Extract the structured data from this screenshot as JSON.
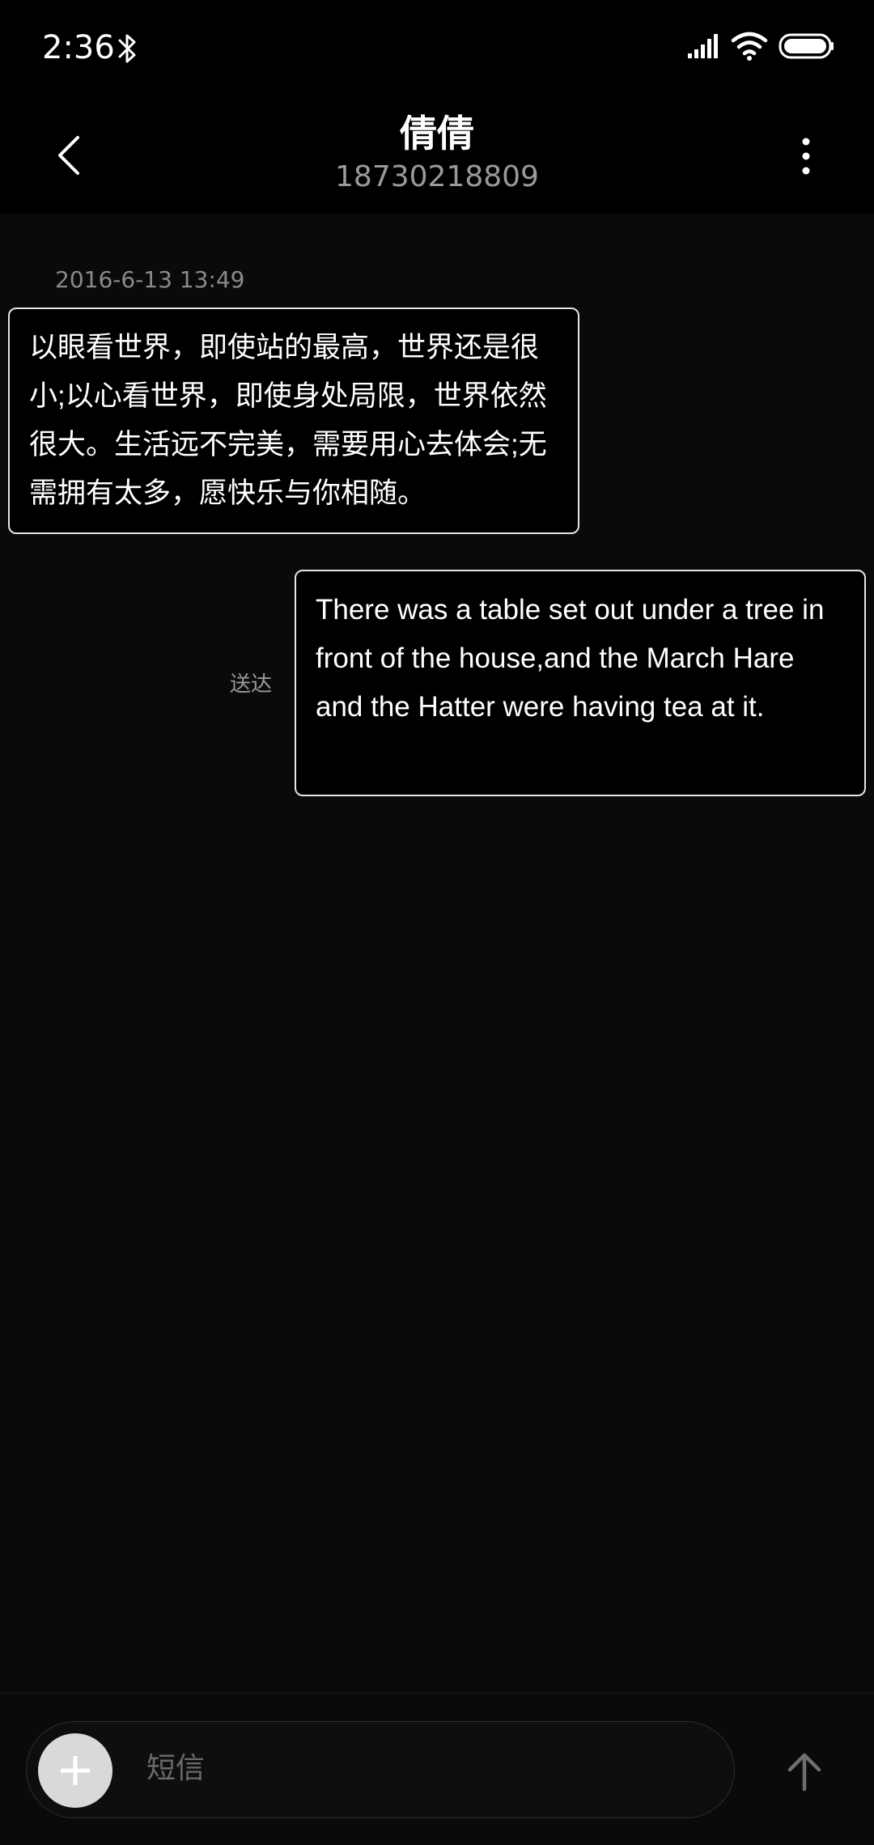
{
  "status_bar": {
    "time": "2:36",
    "icons": [
      "bluetooth-icon",
      "signal-icon",
      "wifi-icon",
      "battery-icon"
    ]
  },
  "header": {
    "contact_name": "倩倩",
    "phone_number": "18730218809",
    "icons": [
      "back-arrow-icon",
      "more-vertical-icon"
    ]
  },
  "conversation": {
    "timestamp": "2016-6-13 13:49",
    "messages": [
      {
        "direction": "incoming",
        "text": "以眼看世界，即使站的最高，世界还是很小;以心看世界，即使身处局限，世界依然很大。生活远不完美，需要用心去体会;无需拥有太多，愿快乐与你相随。"
      },
      {
        "direction": "outgoing",
        "text": "There was a table set out under a tree in front of the house,and the March Hare and the Hatter were having tea at it.",
        "status": "送达"
      }
    ]
  },
  "input_bar": {
    "placeholder": "短信",
    "icons": [
      "plus-icon",
      "send-arrow-icon"
    ]
  },
  "colors": {
    "background": "#0a0a0a",
    "bar_background": "#000000",
    "bubble_border": "#e6e6e6",
    "secondary_text": "#9a9a9a"
  }
}
